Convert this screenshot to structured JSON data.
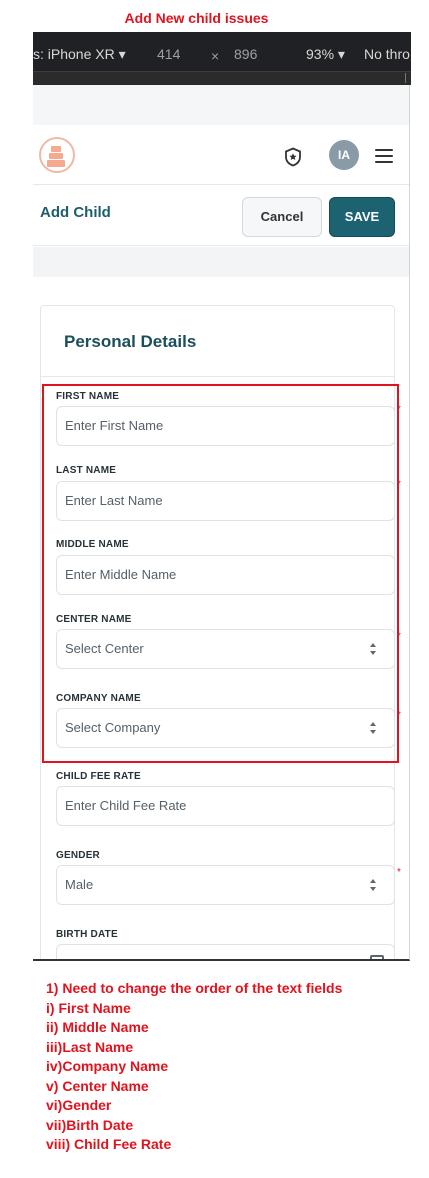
{
  "annotation": {
    "title": "Add New child issues",
    "notes": [
      "1) Need to change the order of the text fields",
      "i) First Name",
      "ii) Middle Name",
      "iii)Last Name",
      "iv)Company Name",
      "v) Center Name",
      "vi)Gender",
      "vii)Birth Date",
      "viii) Child Fee Rate"
    ],
    "highlight_color": "#e0141e"
  },
  "devtools": {
    "device": "s: iPhone XR",
    "width": "414",
    "times": "×",
    "height": "896",
    "zoom": "93%",
    "throttle": "No thro"
  },
  "navbar": {
    "logo": "brand-logo",
    "shield_icon": "shield-star-icon",
    "avatar_initials": "IA",
    "menu_icon": "hamburger-menu-icon"
  },
  "subheader": {
    "title": "Add Child",
    "cancel_label": "Cancel",
    "save_label": "SAVE",
    "save_color": "#1c6270"
  },
  "card": {
    "title": "Personal Details"
  },
  "fields": {
    "first_name": {
      "label": "FIRST NAME",
      "placeholder": "Enter First Name",
      "required": "*"
    },
    "last_name": {
      "label": "LAST NAME",
      "placeholder": "Enter Last Name",
      "required": "*"
    },
    "middle_name": {
      "label": "MIDDLE NAME",
      "placeholder": "Enter Middle Name"
    },
    "center_name": {
      "label": "CENTER NAME",
      "value": "Select Center",
      "required": "*"
    },
    "company_name": {
      "label": "COMPANY NAME",
      "value": "Select Company",
      "required": "*"
    },
    "child_fee_rate": {
      "label": "CHILD FEE RATE",
      "placeholder": "Enter Child Fee Rate"
    },
    "gender": {
      "label": "GENDER",
      "value": "Male",
      "required": "*"
    },
    "birth_date": {
      "label": "BIRTH DATE"
    }
  }
}
